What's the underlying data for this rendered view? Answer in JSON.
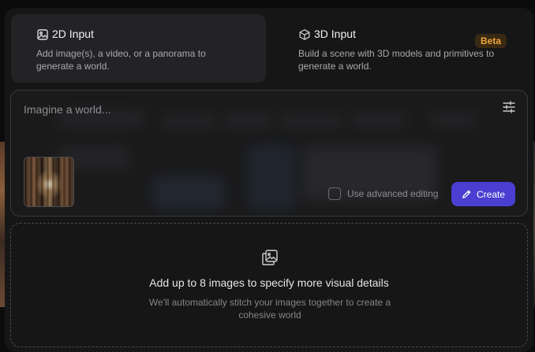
{
  "modes": [
    {
      "id": "2d",
      "title": "2D Input",
      "icon": "image-icon",
      "description": "Add image(s), a video, or a panorama to generate a world.",
      "active": true
    },
    {
      "id": "3d",
      "title": "3D Input",
      "icon": "cube-icon",
      "badge": "Beta",
      "description": "Build a scene with 3D models and primitives to generate a world.",
      "active": false
    }
  ],
  "prompt": {
    "placeholder": "Imagine a world...",
    "settings_icon": "sliders-icon",
    "thumbnail_icon": "image-thumbnail",
    "advanced_editing_label": "Use advanced editing",
    "advanced_editing_checked": false,
    "create_label": "Create",
    "create_icon": "pencil-icon"
  },
  "dropzone": {
    "icon": "add-images-icon",
    "title": "Add up to 8 images to specify more visual details",
    "subtitle": "We'll automatically stitch your images together to create a cohesive world"
  },
  "colors": {
    "accent": "#4a3fd0",
    "beta_text": "#f0a53a",
    "beta_bg": "#3a2a13",
    "panel_bg": "#161617"
  }
}
